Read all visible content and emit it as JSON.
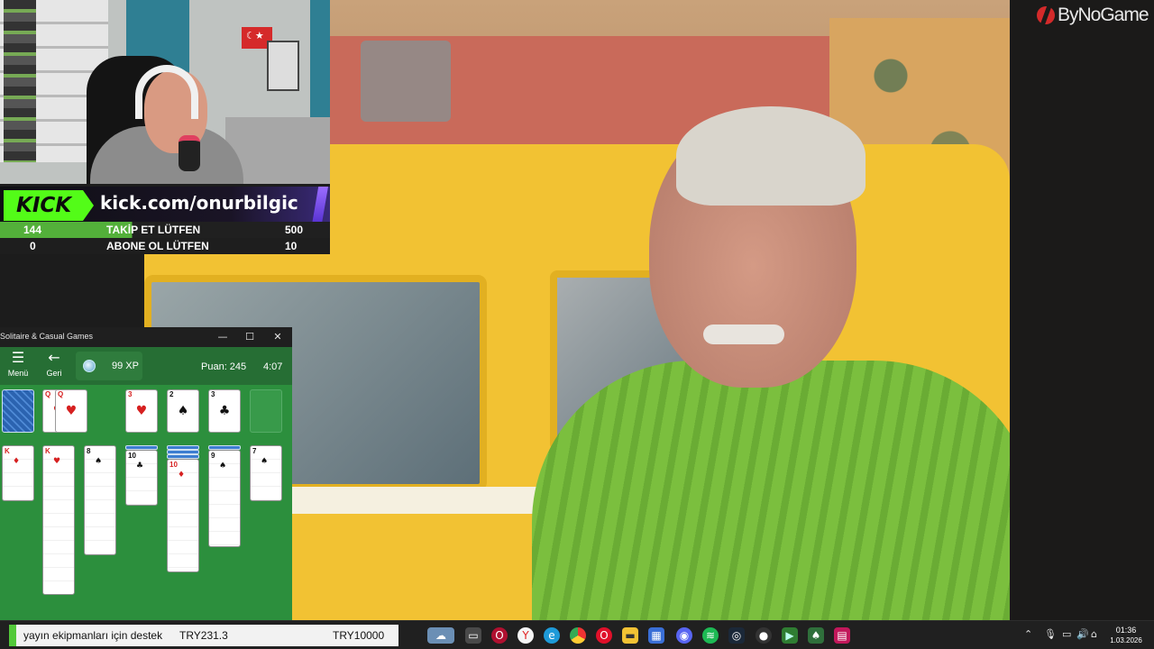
{
  "overlay": {
    "logo_text": "ByNoGame",
    "kick_badge": "KICK",
    "kick_url": "kick.com/onurbilgic",
    "stats": [
      {
        "value": "144",
        "label": "TAKİP ET LÜTFEN",
        "goal": "500"
      },
      {
        "value": "0",
        "label": "ABONE OL LÜTFEN",
        "goal": "10"
      }
    ]
  },
  "solitaire": {
    "title": "Solitaire & Casual Games",
    "window_controls": {
      "minimize": "—",
      "maximize": "☐",
      "close": "✕"
    },
    "menu_label": "Menü",
    "back_label": "Geri",
    "xp": "99 XP",
    "score": "Puan: 245",
    "timer": "4:07",
    "foundation": [
      {
        "rank": "Q",
        "suit": "♥",
        "color": "red"
      },
      {
        "rank": "3",
        "suit": "♥",
        "color": "red"
      },
      {
        "rank": "2",
        "suit": "♠",
        "color": "black"
      },
      {
        "rank": "3",
        "suit": "♣",
        "color": "black"
      }
    ],
    "columns": [
      {
        "rank": "K",
        "suit": "♦",
        "color": "red"
      },
      {
        "rank": "K",
        "suit": "♥",
        "color": "red"
      },
      {
        "rank": "8",
        "suit": "♠",
        "color": "black"
      },
      {
        "rank": "10",
        "suit": "♣",
        "color": "black"
      },
      {
        "rank": "10",
        "suit": "♦",
        "color": "red"
      },
      {
        "rank": "9",
        "suit": "♠",
        "color": "black"
      },
      {
        "rank": "7",
        "suit": "♠",
        "color": "black"
      }
    ]
  },
  "taskbar": {
    "donation_message": "yayın ekipmanları için destek",
    "donation_amount_1": "TRY231.3",
    "donation_amount_2": "TRY10000",
    "time": "01:36",
    "date": "1.03.2026",
    "apps": [
      "weather-icon",
      "explorer-icon",
      "opera-gx-icon",
      "yandex-icon",
      "edge-icon",
      "chrome-icon",
      "opera-icon",
      "folder-icon",
      "store-icon",
      "discord-icon",
      "spotify-icon",
      "steam-icon",
      "obs-icon",
      "terminal-icon",
      "solitaire-app-icon",
      "sheets-icon"
    ]
  }
}
